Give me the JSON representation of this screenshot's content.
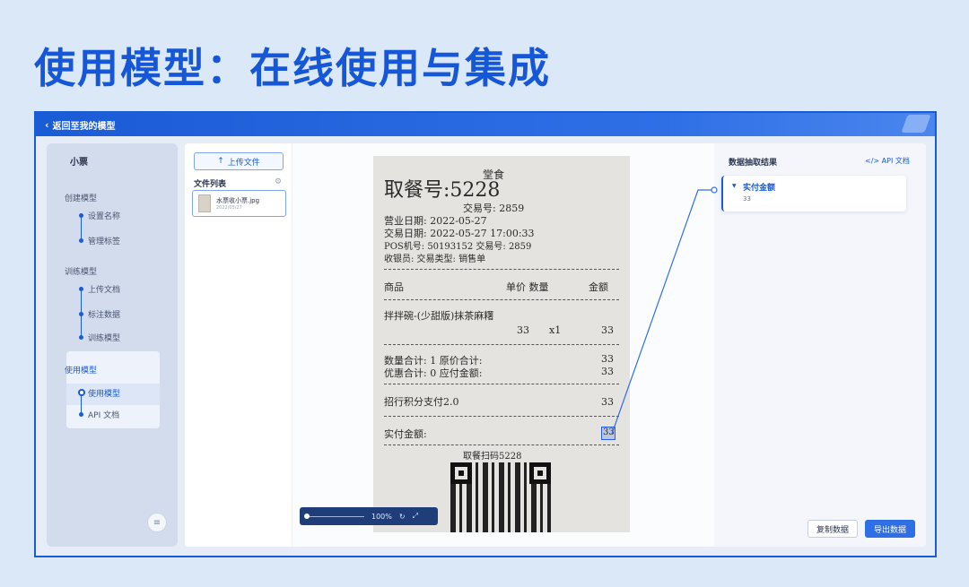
{
  "slide": {
    "title": "使用模型：在线使用与集成"
  },
  "header": {
    "back_label": "返回至我的模型"
  },
  "sidebar": {
    "title": "小票",
    "sections": [
      {
        "label": "创建模型",
        "steps": [
          "设置名称",
          "管理标签"
        ]
      },
      {
        "label": "训练模型",
        "steps": [
          "上传文档",
          "标注数据",
          "训练模型"
        ]
      },
      {
        "label": "使用模型",
        "steps": [
          "使用模型",
          "API 文档"
        ]
      }
    ],
    "toggle_icon": "collapse-menu-icon"
  },
  "files": {
    "upload_label": "上传文件",
    "list_title": "文件列表",
    "items": [
      {
        "name": "水票收小票.jpg",
        "date": "2022/05/27"
      }
    ]
  },
  "preview": {
    "zoom": "100%",
    "receipt": {
      "header": "堂食",
      "order_label": "取餐号:5228",
      "trade_no_top": "交易号: 2859",
      "business_date": "营业日期: 2022-05-27",
      "trade_date": "交易日期: 2022-05-27 17:00:33",
      "pos_line": "POS机号:   50193152 交易号:     2859",
      "cashier_line": "收银员:             交易类型:  销售单",
      "col_item": "商品",
      "col_price_qty": "单价  数量",
      "col_amount": "金额",
      "item_name": "拌拌碗-(少甜版)抹茶麻糬",
      "item_price": "33",
      "item_qty": "x1",
      "item_amount": "33",
      "qty_total": "数量合计:      1   原价合计:",
      "qty_total_val": "33",
      "discount_total": "优惠合计:      0   应付金额:",
      "discount_total_val": "33",
      "points_pay": "招行积分支付2.0",
      "points_pay_val": "33",
      "actual_paid": "实付金额:",
      "actual_paid_val": "33",
      "qr_caption": "取餐扫码5228"
    }
  },
  "results": {
    "title": "数据抽取结果",
    "api_link": "</> API 文档",
    "fields": [
      {
        "label": "实付金额",
        "value": "33"
      }
    ],
    "copy_label": "复制数据",
    "export_label": "导出数据"
  },
  "colors": {
    "accent": "#1a5bd6",
    "title": "#1557d6",
    "background": "#dbe8f7"
  }
}
